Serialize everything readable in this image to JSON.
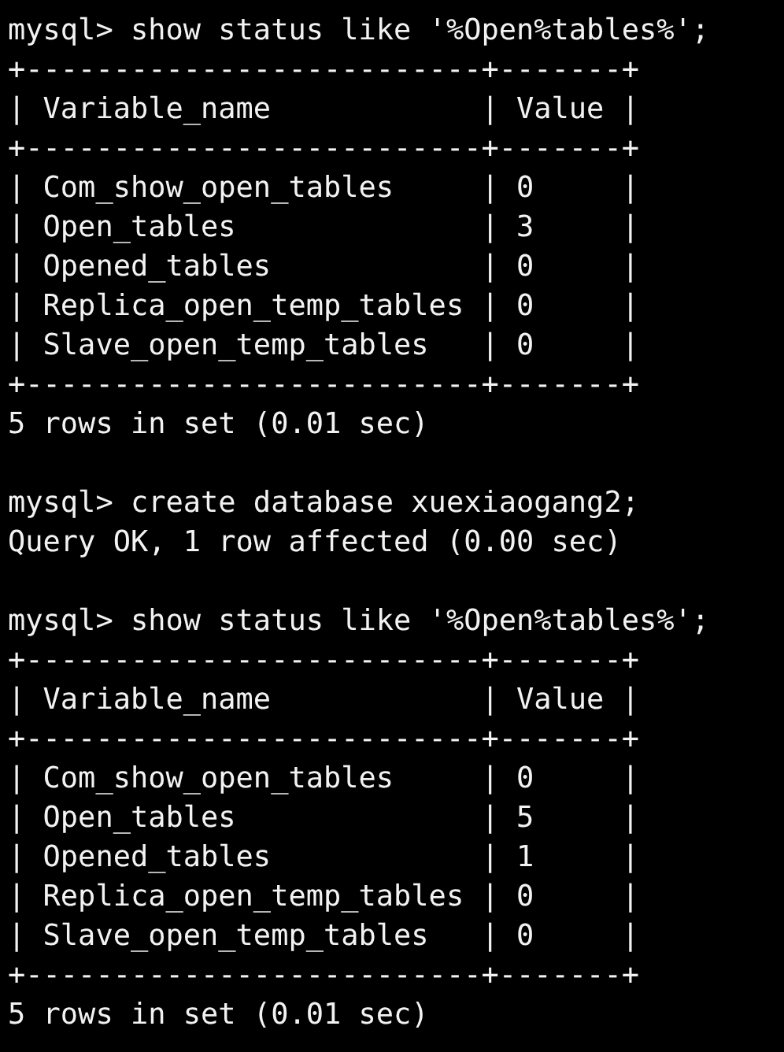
{
  "terminal": {
    "lines": [
      {
        "kind": "text",
        "text": "mysql> show status like '%Open%tables%';"
      },
      {
        "kind": "text",
        "text": "+--------------------------+-------+"
      },
      {
        "kind": "text",
        "text": "| Variable_name            | Value |"
      },
      {
        "kind": "text",
        "text": "+--------------------------+-------+"
      },
      {
        "kind": "text",
        "text": "| Com_show_open_tables     | 0     |"
      },
      {
        "kind": "text",
        "text": "| Open_tables              | 3     |"
      },
      {
        "kind": "text",
        "text": "| Opened_tables            | 0     |"
      },
      {
        "kind": "text",
        "text": "| Replica_open_temp_tables | 0     |"
      },
      {
        "kind": "text",
        "text": "| Slave_open_temp_tables   | 0     |"
      },
      {
        "kind": "text",
        "text": "+--------------------------+-------+"
      },
      {
        "kind": "text",
        "text": "5 rows in set (0.01 sec)"
      },
      {
        "kind": "blank"
      },
      {
        "kind": "text",
        "text": "mysql> create database xuexiaogang2;"
      },
      {
        "kind": "text",
        "text": "Query OK, 1 row affected (0.00 sec)"
      },
      {
        "kind": "blank"
      },
      {
        "kind": "text",
        "text": "mysql> show status like '%Open%tables%';"
      },
      {
        "kind": "text",
        "text": "+--------------------------+-------+"
      },
      {
        "kind": "text",
        "text": "| Variable_name            | Value |"
      },
      {
        "kind": "text",
        "text": "+--------------------------+-------+"
      },
      {
        "kind": "text",
        "text": "| Com_show_open_tables     | 0     |"
      },
      {
        "kind": "text",
        "text": "| Open_tables              | 5     |"
      },
      {
        "kind": "text",
        "text": "| Opened_tables            | 1     |"
      },
      {
        "kind": "text",
        "text": "| Replica_open_temp_tables | 0     |"
      },
      {
        "kind": "text",
        "text": "| Slave_open_temp_tables   | 0     |"
      },
      {
        "kind": "text",
        "text": "+--------------------------+-------+"
      },
      {
        "kind": "text",
        "text": "5 rows in set (0.01 sec)"
      }
    ]
  }
}
